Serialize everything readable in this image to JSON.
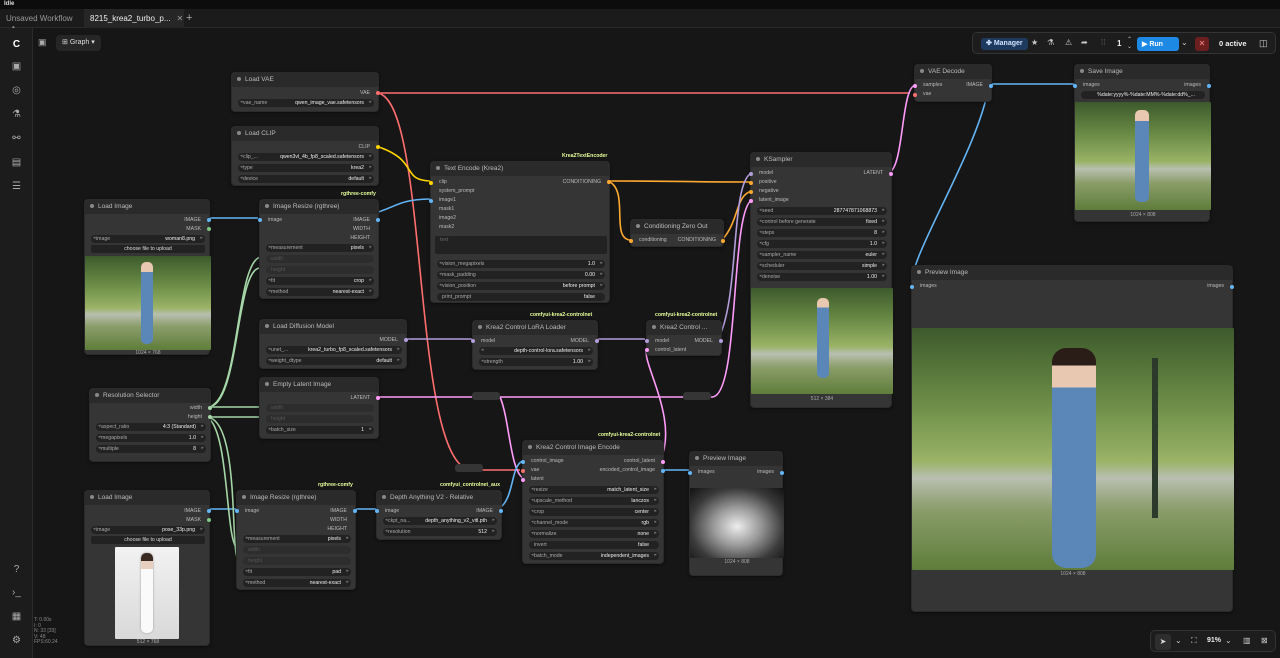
{
  "app": {
    "status": "Idle"
  },
  "tabs": [
    {
      "label": "Unsaved Workflow",
      "active": false
    },
    {
      "label": "8215_krea2_turbo_p...",
      "active": true
    }
  ],
  "toolbar": {
    "graph_label": "Graph",
    "manager_label": "Manager",
    "queue_count": "1",
    "run_label": "Run",
    "active_label": "0 active"
  },
  "stats": [
    "T: 0.00s",
    "I: 0",
    "N: 33 [33]",
    "V: 48",
    "FPS:60.24"
  ],
  "zoom": {
    "value": "91%"
  },
  "colors": {
    "accent": "#1e88e5",
    "wire_vae": "#ff6e6e",
    "wire_clip": "#ffd500",
    "wire_image": "#64b5f6",
    "wire_latent": "#ff9cf9",
    "wire_model": "#b39ddb",
    "wire_cond": "#ffa931",
    "wire_int": "#a5d6a7",
    "badge": "#e6ff9a"
  },
  "nodes": {
    "load_vae": {
      "title": "Load VAE",
      "out": "VAE",
      "w_vae_name_k": "vae_name",
      "w_vae_name_v": "qwen_image_vae.safetensors"
    },
    "load_clip": {
      "title": "Load CLIP",
      "out": "CLIP",
      "w_clip_k": "clip_...",
      "w_clip_v": "qwen3vl_4b_fp8_scaled.safetensors",
      "w_type_k": "type",
      "w_type_v": "krea2",
      "w_device_k": "device",
      "w_device_v": "default"
    },
    "text_encode": {
      "badge": "Krea2TextEncoder",
      "title": "Text Encode (Krea2)",
      "in_clip": "clip",
      "in_sys": "system_prompt",
      "in_image1": "image1",
      "in_mask1": "mask1",
      "in_image2": "image2",
      "in_mask2": "mask2",
      "out": "CONDITIONING",
      "text_placeholder": "text",
      "w_vm_k": "vision_megapixels",
      "w_vm_v": "1.0",
      "w_mp_k": "mask_padding",
      "w_mp_v": "0.00",
      "w_vp_k": "vision_position",
      "w_vp_v": "before prompt",
      "w_pp_k": "print_prompt",
      "w_pp_v": "false"
    },
    "cond_zero": {
      "title": "Conditioning Zero Out",
      "in": "conditioning",
      "out": "CONDITIONING"
    },
    "ksampler": {
      "title": "KSampler",
      "in_model": "model",
      "in_pos": "positive",
      "in_neg": "negative",
      "in_latent": "latent_image",
      "out": "LATENT",
      "w_seed_k": "seed",
      "w_seed_v": "287747871068873",
      "w_cbg_k": "control before generate",
      "w_cbg_v": "fixed",
      "w_steps_k": "steps",
      "w_steps_v": "8",
      "w_cfg_k": "cfg",
      "w_cfg_v": "1.0",
      "w_sampler_k": "sampler_name",
      "w_sampler_v": "euler",
      "w_sched_k": "scheduler",
      "w_sched_v": "simple",
      "w_denoise_k": "denoise",
      "w_denoise_v": "1.00",
      "caption": "512 × 384"
    },
    "vae_decode": {
      "title": "VAE Decode",
      "in_samples": "samples",
      "in_vae": "vae",
      "out": "IMAGE"
    },
    "save_image": {
      "title": "Save Image",
      "in": "images",
      "out": "images",
      "w_prefix_v": "%date:yyyy%-%date:MM%-%date:dd%_...",
      "caption": "1024 × 808"
    },
    "preview_main": {
      "title": "Preview Image",
      "in": "images",
      "out": "images",
      "caption": "1024 × 808"
    },
    "load_image_1": {
      "title": "Load Image",
      "out_image": "IMAGE",
      "out_mask": "MASK",
      "w_image_k": "image",
      "w_image_v": "woman8.png",
      "upload_label": "choose file to upload",
      "caption": "1024 × 768"
    },
    "resize_1": {
      "badge": "rgthree-comfy",
      "title": "Image Resize (rgthree)",
      "in_image": "image",
      "in_width": "width",
      "in_height": "height",
      "out_image": "IMAGE",
      "out_width": "WIDTH",
      "out_height": "HEIGHT",
      "w_meas_k": "measurement",
      "w_meas_v": "pixels",
      "w_fit_k": "fit",
      "w_fit_v": "crop",
      "w_method_k": "method",
      "w_method_v": "nearest-exact"
    },
    "load_diffusion": {
      "title": "Load Diffusion Model",
      "out": "MODEL",
      "w_unet_k": "unet_...",
      "w_unet_v": "krea2_turbo_fp8_scaled.safetensors",
      "w_dtype_k": "weight_dtype",
      "w_dtype_v": "default"
    },
    "lora_loader": {
      "badge": "comfyui-krea2-controlnet",
      "title": "Krea2 Control LoRA Loader",
      "in": "model",
      "out": "MODEL",
      "w_lora_v": "depth-control-lora.safetensors",
      "w_strength_k": "strength",
      "w_strength_v": "1.00"
    },
    "krea2_control": {
      "badge": "comfyui-krea2-controlnet",
      "title": "Krea2 Control ...",
      "in_model": "model",
      "in_latent": "control_latent",
      "out": "MODEL"
    },
    "resolution": {
      "title": "Resolution Selector",
      "out_width": "width",
      "out_height": "height",
      "w_ar_k": "aspect_ratio",
      "w_ar_v": "4:3 (Standard)",
      "w_mp_k": "megapixels",
      "w_mp_v": "1.0",
      "w_mul_k": "multiple",
      "w_mul_v": "8"
    },
    "empty_latent": {
      "title": "Empty Latent Image",
      "in_width": "width",
      "in_height": "height",
      "out": "LATENT",
      "w_batch_k": "batch_size",
      "w_batch_v": "1"
    },
    "ctrl_encode": {
      "badge": "comfyui-krea2-controlnet",
      "title": "Krea2 Control Image Encode",
      "in_ci": "control_image",
      "in_vae": "vae",
      "in_latent": "latent",
      "out_cl": "control_latent",
      "out_eci": "encoded_control_image",
      "w_resize_k": "resize",
      "w_resize_v": "match_latent_size",
      "w_up_k": "upscale_method",
      "w_up_v": "lanczos",
      "w_crop_k": "crop",
      "w_crop_v": "center",
      "w_cm_k": "channel_mode",
      "w_cm_v": "rgb",
      "w_norm_k": "normalize",
      "w_norm_v": "none",
      "w_inv_k": "invert",
      "w_inv_v": "false",
      "w_bm_k": "batch_mode",
      "w_bm_v": "independent_images"
    },
    "preview_depth": {
      "title": "Preview Image",
      "in": "images",
      "out": "images",
      "caption": "1024 × 808"
    },
    "load_image_2": {
      "title": "Load Image",
      "out_image": "IMAGE",
      "out_mask": "MASK",
      "w_image_k": "image",
      "w_image_v": "pose_33p.png",
      "upload_label": "choose file to upload",
      "caption": "512 × 768"
    },
    "resize_2": {
      "badge": "rgthree-comfy",
      "title": "Image Resize (rgthree)",
      "in_image": "image",
      "in_width": "width",
      "in_height": "height",
      "out_image": "IMAGE",
      "out_width": "WIDTH",
      "out_height": "HEIGHT",
      "w_meas_k": "measurement",
      "w_meas_v": "pixels",
      "w_fit_k": "fit",
      "w_fit_v": "pad",
      "w_method_k": "method",
      "w_method_v": "nearest-exact"
    },
    "depth_anything": {
      "badge": "comfyui_controlnet_aux",
      "title": "Depth Anything V2 - Relative",
      "in": "image",
      "out": "IMAGE",
      "w_ckpt_k": "ckpt_na...",
      "w_ckpt_v": "depth_anything_v2_vitl.pth",
      "w_res_k": "resolution",
      "w_res_v": "512"
    }
  }
}
